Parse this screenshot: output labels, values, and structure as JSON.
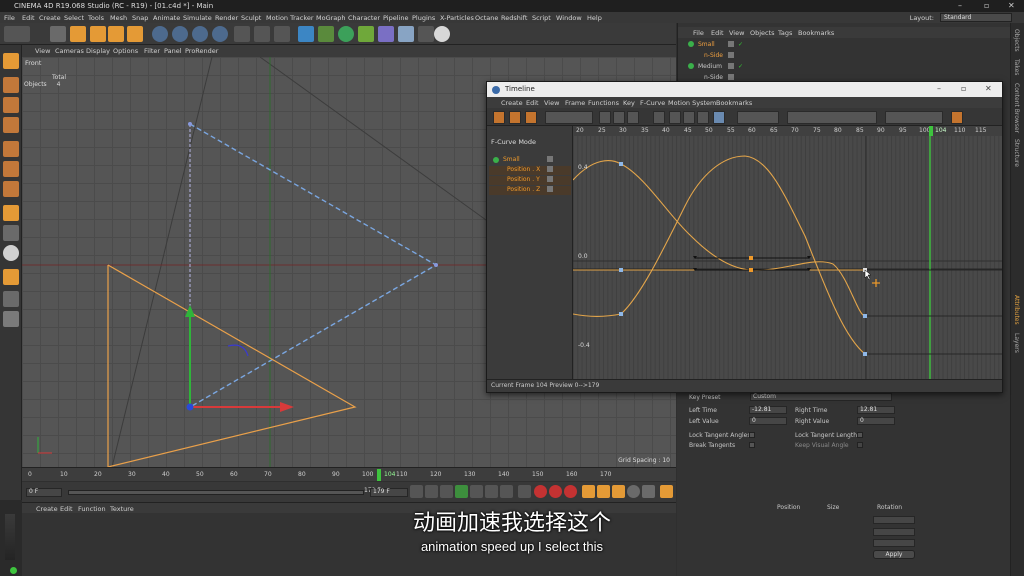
{
  "app": {
    "title": "CINEMA 4D R19.068 Studio (RC - R19) - [01.c4d *] - Main",
    "menu": [
      "File",
      "Edit",
      "Create",
      "Select",
      "Tools",
      "Mesh",
      "Snap",
      "Animate",
      "Simulate",
      "Render",
      "Sculpt",
      "Motion Tracker",
      "MoGraph",
      "Character",
      "Pipeline",
      "Plugins",
      "X-Particles",
      "Octane",
      "Redshift",
      "Script",
      "Window",
      "Help"
    ],
    "layout_label": "Layout:",
    "layout_value": "Standard"
  },
  "viewport": {
    "menu": [
      "View",
      "Cameras",
      "Display",
      "Options",
      "Filter",
      "Panel",
      "ProRender"
    ],
    "label": "Front",
    "stats_total": "Total",
    "stats_objects_label": "Objects",
    "stats_objects_value": "4",
    "grid_spacing": "Grid Spacing : 10"
  },
  "ruler": {
    "ticks": [
      "0",
      "10",
      "20",
      "30",
      "40",
      "50",
      "60",
      "70",
      "80",
      "90",
      "100",
      "104",
      "110",
      "120",
      "130",
      "140",
      "150",
      "160",
      "170"
    ],
    "current": "104"
  },
  "transport": {
    "start": "0 F",
    "end": "179 F",
    "end2": "179 F"
  },
  "material": {
    "menu": [
      "Create",
      "Edit",
      "Function",
      "Texture"
    ]
  },
  "object_manager": {
    "menu": [
      "File",
      "Edit",
      "View",
      "Objects",
      "Tags",
      "Bookmarks"
    ],
    "rows": [
      {
        "name": "Small",
        "child": "n-Side"
      },
      {
        "name": "Medium",
        "child": "n-Side"
      }
    ]
  },
  "timeline": {
    "title": "Timeline",
    "menu": [
      "Create",
      "Edit",
      "View",
      "Frame",
      "Functions",
      "Key",
      "F-Curve",
      "Motion System",
      "Bookmarks"
    ],
    "mode": "F-Curve Mode",
    "tracks": [
      "Small",
      "Position . X",
      "Position . Y",
      "Position . Z"
    ],
    "ruler": [
      "20",
      "25",
      "30",
      "35",
      "40",
      "45",
      "50",
      "55",
      "60",
      "65",
      "70",
      "75",
      "80",
      "85",
      "90",
      "95",
      "100",
      "104",
      "110",
      "115"
    ],
    "y_labels": [
      "0.4",
      "0.0",
      "-0.4"
    ],
    "status": "Current Frame  104   Preview  0-->179"
  },
  "attributes": {
    "key_preset_label": "Key Preset",
    "key_preset_value": "Custom",
    "left_time_label": "Left  Time",
    "left_time_value": "-12.81",
    "right_time_label": "Right Time",
    "right_time_value": "12.81",
    "left_value_label": "Left  Value",
    "left_value_value": "0",
    "right_value_label": "Right Value",
    "right_value_value": "0",
    "lock_tangent_angles": "Lock Tangent Angles",
    "lock_tangent_lengths": "Lock Tangent Lengths",
    "break_tangents": "Break Tangents",
    "keep_visual_angle": "Keep Visual Angle",
    "position_label": "Position",
    "size_label": "Size",
    "rotation_label": "Rotation",
    "apply": "Apply"
  },
  "right_tabs": [
    "Objects",
    "Takes",
    "Content Browser",
    "Structure",
    "Attributes",
    "Layers"
  ],
  "subtitle": {
    "cn": "动画加速我选择这个",
    "en": "animation speed up I select this"
  },
  "colors": {
    "accent": "#f09a2a",
    "curve": "#e3a54a",
    "frame_marker": "#3ec43e"
  }
}
